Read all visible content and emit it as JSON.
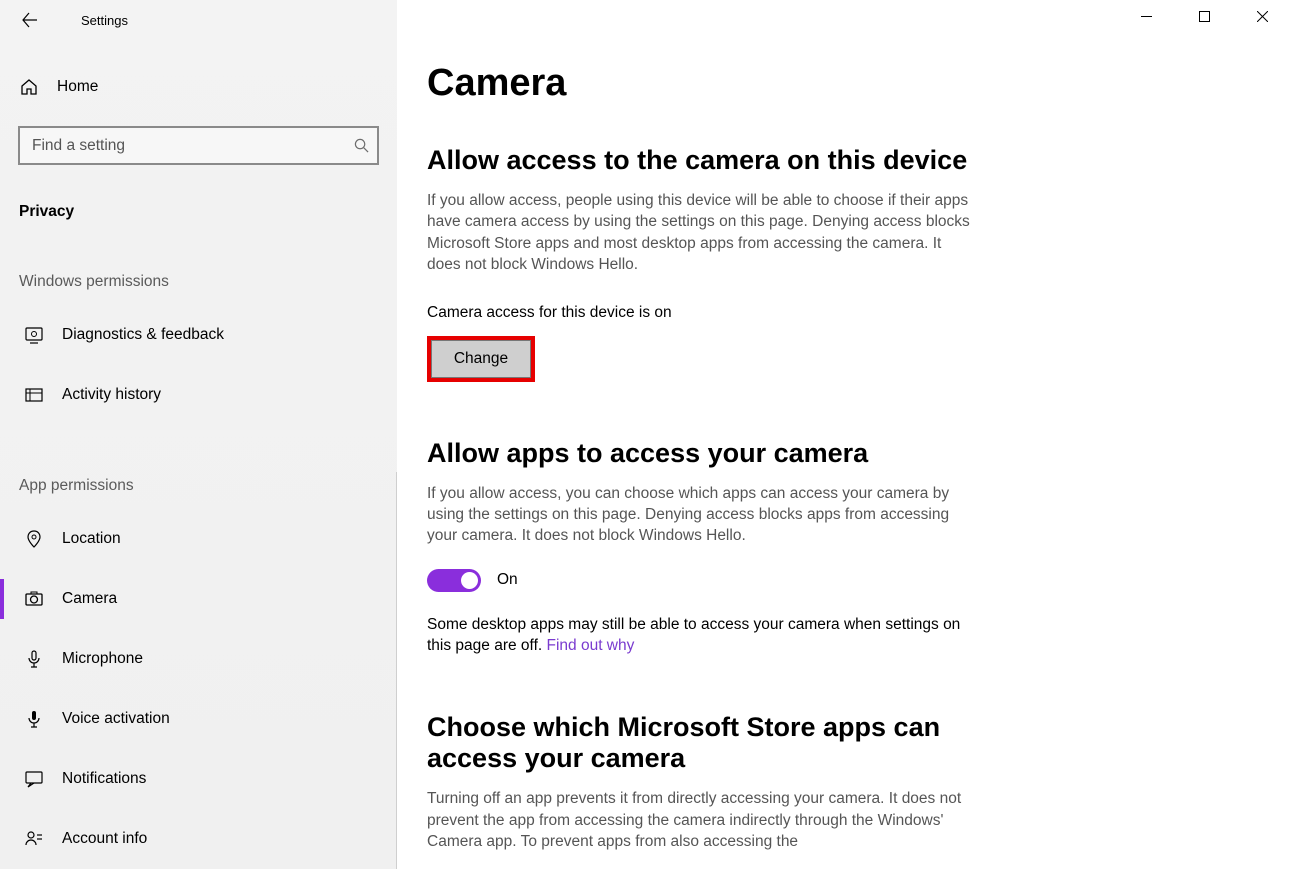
{
  "titlebar": {
    "label": "Settings"
  },
  "sidebar": {
    "home_label": "Home",
    "search_placeholder": "Find a setting",
    "category_label": "Privacy",
    "group1_label": "Windows permissions",
    "group2_label": "App permissions",
    "items": {
      "diagnostics": "Diagnostics & feedback",
      "activity": "Activity history",
      "location": "Location",
      "camera": "Camera",
      "microphone": "Microphone",
      "voice": "Voice activation",
      "notifications": "Notifications",
      "account": "Account info"
    }
  },
  "main": {
    "page_title": "Camera",
    "section1": {
      "title": "Allow access to the camera on this device",
      "desc": "If you allow access, people using this device will be able to choose if their apps have camera access by using the settings on this page. Denying access blocks Microsoft Store apps and most desktop apps from accessing the camera. It does not block Windows Hello.",
      "status": "Camera access for this device is on",
      "change_label": "Change"
    },
    "section2": {
      "title": "Allow apps to access your camera",
      "desc": "If you allow access, you can choose which apps can access your camera by using the settings on this page. Denying access blocks apps from accessing your camera. It does not block Windows Hello.",
      "toggle_label": "On",
      "note_prefix": "Some desktop apps may still be able to access your camera when settings on this page are off. ",
      "link_label": "Find out why"
    },
    "section3": {
      "title": "Choose which Microsoft Store apps can access your camera",
      "desc": "Turning off an app prevents it from directly accessing your camera. It does not prevent the app from accessing the camera indirectly through the Windows' Camera app. To prevent apps from also accessing the"
    }
  }
}
